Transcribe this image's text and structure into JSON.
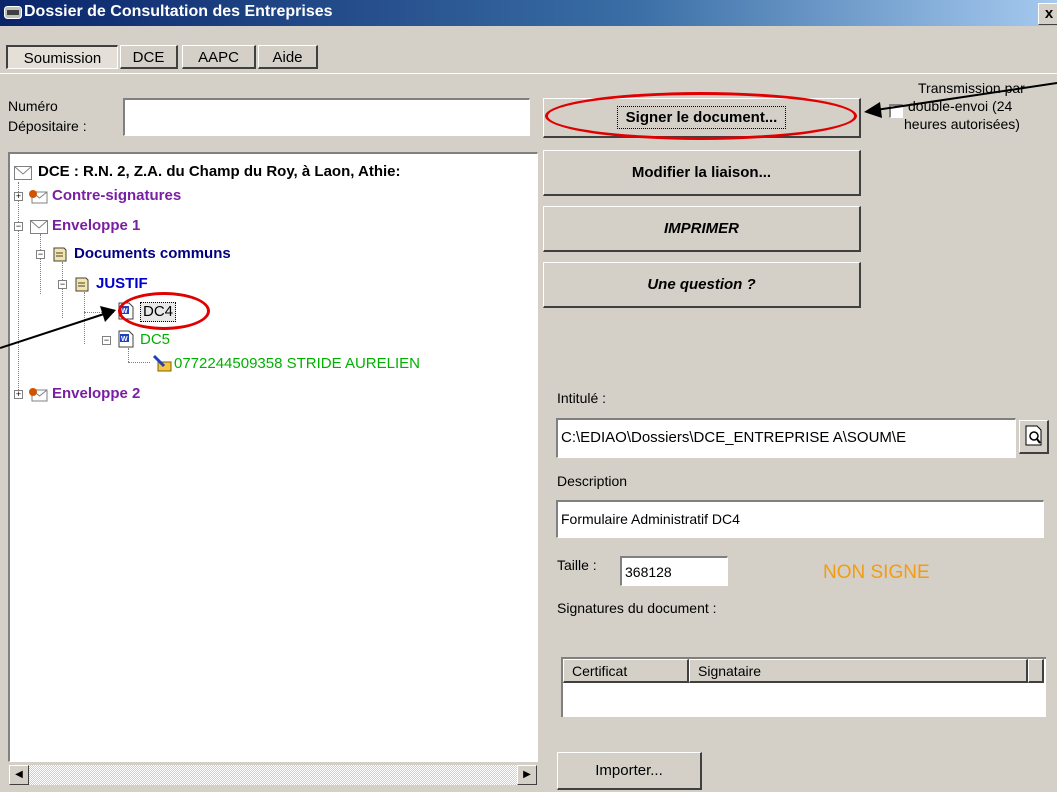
{
  "window": {
    "title": "Dossier de Consultation des Entreprises",
    "close_label": "x"
  },
  "tabs": [
    {
      "label": "Soumission",
      "active": true
    },
    {
      "label": "DCE",
      "active": false
    },
    {
      "label": "AAPC",
      "active": false
    },
    {
      "label": "Aide",
      "active": false
    }
  ],
  "depositaire": {
    "label_line1": "Numéro",
    "label_line2": "Dépositaire :",
    "value": ""
  },
  "tree": {
    "root": "DCE : R.N. 2, Z.A. du Champ du Roy, à Laon, Athie:",
    "contre_signatures": "Contre-signatures",
    "enveloppe1": "Enveloppe 1",
    "documents_communs": "Documents communs",
    "justif": "JUSTIF",
    "dc4": "DC4",
    "dc5": "DC5",
    "signer_entry": "0772244509358 STRIDE AURELIEN",
    "enveloppe2": "Enveloppe 2"
  },
  "buttons": {
    "signer": "Signer le document...",
    "modifier": "Modifier la liaison...",
    "imprimer": "IMPRIMER",
    "question": "Une question ?",
    "importer": "Importer..."
  },
  "transmission": {
    "line1": "Transmission par",
    "line2": "double-envoi (24",
    "line3": "heures autorisées)",
    "checked": false
  },
  "fields": {
    "intitule_label": "Intitulé :",
    "intitule_value": "C:\\EDIAO\\Dossiers\\DCE_ENTREPRISE A\\SOUM\\E",
    "description_label": "Description",
    "description_value": "Formulaire Administratif DC4",
    "taille_label": "Taille :",
    "taille_value": "368128",
    "status": "NON SIGNE",
    "signatures_label": "Signatures du document :"
  },
  "signatures_table": {
    "columns": [
      "Certificat",
      "Signataire"
    ]
  },
  "colors": {
    "status": "#f39c12",
    "purple": "#7b1fa2",
    "navy": "#000080",
    "green": "#00b000",
    "annotation": "#e00000"
  },
  "icons": [
    "envelope-icon",
    "signature-envelope-icon",
    "folder-doc-icon",
    "word-doc-icon",
    "signature-pen-icon",
    "browse-icon"
  ]
}
